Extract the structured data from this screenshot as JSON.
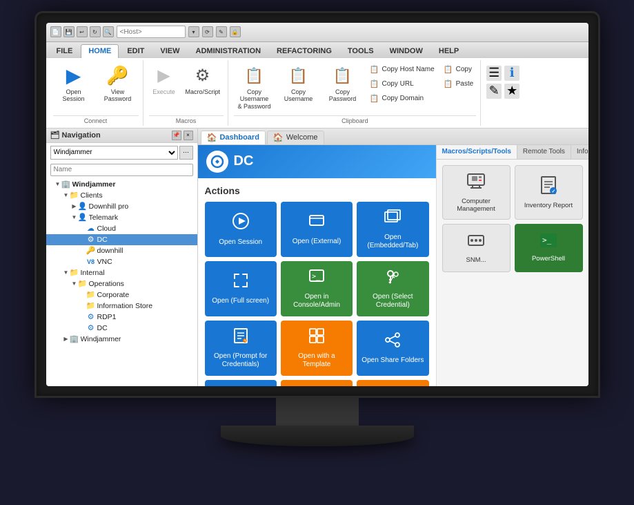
{
  "titlebar": {
    "icons": [
      "doc",
      "save",
      "undo",
      "refresh",
      "search"
    ],
    "host_placeholder": "<Host>",
    "window_controls": [
      "_",
      "□",
      "×"
    ]
  },
  "ribbon": {
    "tabs": [
      {
        "label": "FILE",
        "active": false
      },
      {
        "label": "HOME",
        "active": true
      },
      {
        "label": "EDIT",
        "active": false
      },
      {
        "label": "VIEW",
        "active": false
      },
      {
        "label": "ADMINISTRATION",
        "active": false
      },
      {
        "label": "REFACTORING",
        "active": false
      },
      {
        "label": "TOOLS",
        "active": false
      },
      {
        "label": "WINDOW",
        "active": false
      },
      {
        "label": "HELP",
        "active": false
      }
    ],
    "groups": {
      "connect": {
        "label": "Connect",
        "buttons": [
          {
            "id": "open-session",
            "icon": "▶",
            "label": "Open Session"
          },
          {
            "id": "view-password",
            "icon": "🔑",
            "label": "View Password"
          }
        ]
      },
      "macros": {
        "label": "Macros",
        "buttons": [
          {
            "id": "execute",
            "icon": "▶",
            "label": "Execute"
          },
          {
            "id": "macro-script",
            "icon": "⚙",
            "label": "Macro/Script"
          }
        ]
      },
      "clipboard": {
        "label": "Clipboard",
        "buttons": [
          {
            "id": "copy-user-pass",
            "icon": "📋",
            "label": "Copy Username & Password"
          },
          {
            "id": "copy-username",
            "icon": "📋",
            "label": "Copy Username"
          },
          {
            "id": "copy-password",
            "icon": "📋",
            "label": "Copy Password"
          }
        ],
        "small_buttons": [
          {
            "id": "copy-host-name",
            "icon": "📋",
            "label": "Copy Host Name"
          },
          {
            "id": "copy-url",
            "icon": "📋",
            "label": "Copy URL"
          },
          {
            "id": "copy-domain",
            "icon": "📋",
            "label": "Copy Domain"
          },
          {
            "id": "copy",
            "icon": "📋",
            "label": "Copy"
          },
          {
            "id": "paste",
            "icon": "📋",
            "label": "Paste"
          }
        ]
      }
    }
  },
  "navigation": {
    "title": "Navigation",
    "dropdown_value": "Windjammer",
    "search_placeholder": "Name",
    "tree": [
      {
        "label": "Windjammer",
        "icon": "🏢",
        "indent": 0,
        "expanded": true,
        "bold": true
      },
      {
        "label": "Clients",
        "icon": "📁",
        "indent": 1,
        "expanded": true
      },
      {
        "label": "Downhill pro",
        "icon": "👤",
        "indent": 2,
        "expanded": false
      },
      {
        "label": "Telemark",
        "icon": "👤",
        "indent": 2,
        "expanded": true
      },
      {
        "label": "Cloud",
        "icon": "☁",
        "indent": 3,
        "expanded": false
      },
      {
        "label": "DC",
        "icon": "⚙",
        "indent": 3,
        "selected": true
      },
      {
        "label": "downhill",
        "icon": "🔑",
        "indent": 3,
        "expanded": false
      },
      {
        "label": "VNC",
        "icon": "V",
        "indent": 3,
        "expanded": false
      },
      {
        "label": "Internal",
        "icon": "📁",
        "indent": 1,
        "expanded": true
      },
      {
        "label": "Operations",
        "icon": "📁",
        "indent": 2,
        "expanded": true
      },
      {
        "label": "Corporate",
        "icon": "📁",
        "indent": 3,
        "expanded": false
      },
      {
        "label": "Information Store",
        "icon": "📁",
        "indent": 3,
        "expanded": false
      },
      {
        "label": "RDP1",
        "icon": "⚙",
        "indent": 3,
        "expanded": false
      },
      {
        "label": "DC",
        "icon": "⚙",
        "indent": 3,
        "expanded": false
      },
      {
        "label": "Windjammer",
        "icon": "🏢",
        "indent": 1,
        "expanded": false
      }
    ]
  },
  "content": {
    "tabs": [
      {
        "label": "Dashboard",
        "icon": "🏠",
        "active": true
      },
      {
        "label": "Welcome",
        "icon": "🏠",
        "active": false
      }
    ],
    "dashboard": {
      "entry_name": "DC",
      "section_title": "Actions",
      "tiles": [
        {
          "id": "open-session",
          "label": "Open Session",
          "color": "blue",
          "icon": "▶"
        },
        {
          "id": "open-external",
          "label": "Open (External)",
          "color": "blue",
          "icon": "⬜"
        },
        {
          "id": "open-embedded",
          "label": "Open (Embedded/Tab)",
          "color": "blue",
          "icon": "⬜"
        },
        {
          "id": "open-fullscreen",
          "label": "Open (Full screen)",
          "color": "blue",
          "icon": "⤢"
        },
        {
          "id": "open-console-admin",
          "label": "Open in Console/Admin",
          "color": "green",
          "icon": ">_"
        },
        {
          "id": "open-select-credential",
          "label": "Open (Select Credential)",
          "color": "green",
          "icon": "🔑"
        },
        {
          "id": "open-prompt-credentials",
          "label": "Open (Prompt for Credentials)",
          "color": "blue",
          "icon": "📄"
        },
        {
          "id": "open-with-template",
          "label": "Open with a Template",
          "color": "orange",
          "icon": "⬜"
        },
        {
          "id": "open-share-folders",
          "label": "Open Share Folders",
          "color": "blue",
          "icon": "↗"
        },
        {
          "id": "row2-1",
          "label": "",
          "color": "blue",
          "icon": "📋"
        },
        {
          "id": "row2-2",
          "label": "",
          "color": "orange",
          "icon": "📄"
        },
        {
          "id": "row2-3",
          "label": "",
          "color": "orange",
          "icon": "✏"
        }
      ]
    },
    "tools": {
      "tabs": [
        {
          "label": "Macros/Scripts/Tools",
          "active": true
        },
        {
          "label": "Remote Tools",
          "active": false
        },
        {
          "label": "Info",
          "active": false
        }
      ],
      "tiles": [
        {
          "id": "computer-management",
          "label": "Computer Management",
          "color": "gray",
          "icon": "🖥"
        },
        {
          "id": "inventory-report",
          "label": "Inventory Report",
          "color": "gray",
          "icon": "📋"
        },
        {
          "id": "snmp",
          "label": "SNM...",
          "color": "gray",
          "icon": "📊"
        },
        {
          "id": "powershell",
          "label": "PowerShell",
          "color": "green-dark",
          "icon": ">_"
        }
      ]
    }
  }
}
